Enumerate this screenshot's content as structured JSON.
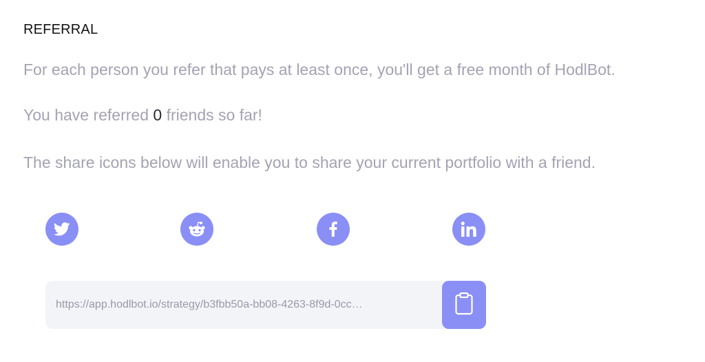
{
  "referral": {
    "title": "REFERRAL",
    "info": "For each person you refer that pays at least once, you'll get a free month of HodlBot.",
    "count_prefix": "You have referred ",
    "count": "0",
    "count_suffix": " friends so far!",
    "share_info": "The share icons below will enable you to share your current portfolio with a friend."
  },
  "share": {
    "buttons": [
      {
        "icon": "twitter-icon"
      },
      {
        "icon": "reddit-icon"
      },
      {
        "icon": "facebook-icon"
      },
      {
        "icon": "linkedin-icon"
      }
    ],
    "url": "https://app.hodlbot.io/strategy/b3fbb50a-bb08-4263-8f9d-0cc…",
    "copy_icon": "clipboard-icon"
  },
  "colors": {
    "accent": "#8a8ff5",
    "muted_text": "#a3a3b3",
    "input_bg": "#f3f4f8"
  }
}
